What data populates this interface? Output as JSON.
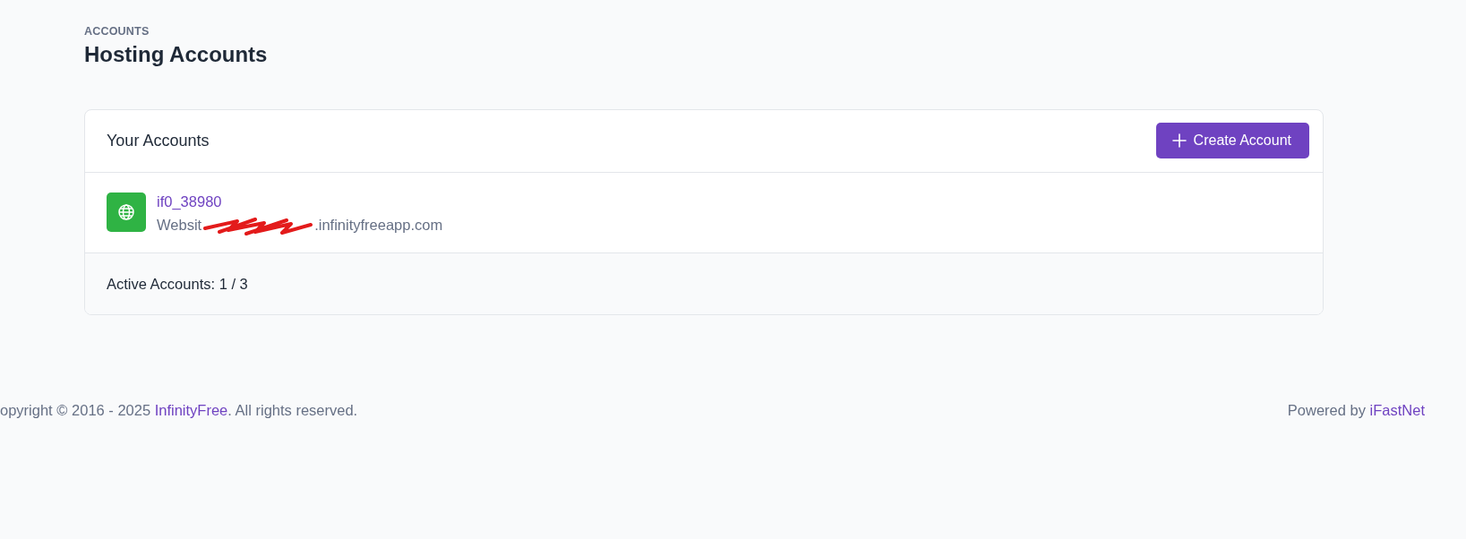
{
  "page_header": {
    "pretitle": "ACCOUNTS",
    "title": "Hosting Accounts"
  },
  "card": {
    "title": "Your Accounts",
    "create_button": "Create Account",
    "accounts": [
      {
        "username": "if0_38980",
        "domain_start": "Websit",
        "domain_end": ".infinityfreeapp.com",
        "redacted": true
      }
    ],
    "footer": "Active Accounts: 1 / 3"
  },
  "footer": {
    "copyright_before": "opyright © 2016 - 2025 ",
    "copyright_link": "InfinityFree",
    "copyright_after": ". All rights reserved.",
    "powered_before": "Powered by ",
    "powered_link": "iFastNet"
  }
}
